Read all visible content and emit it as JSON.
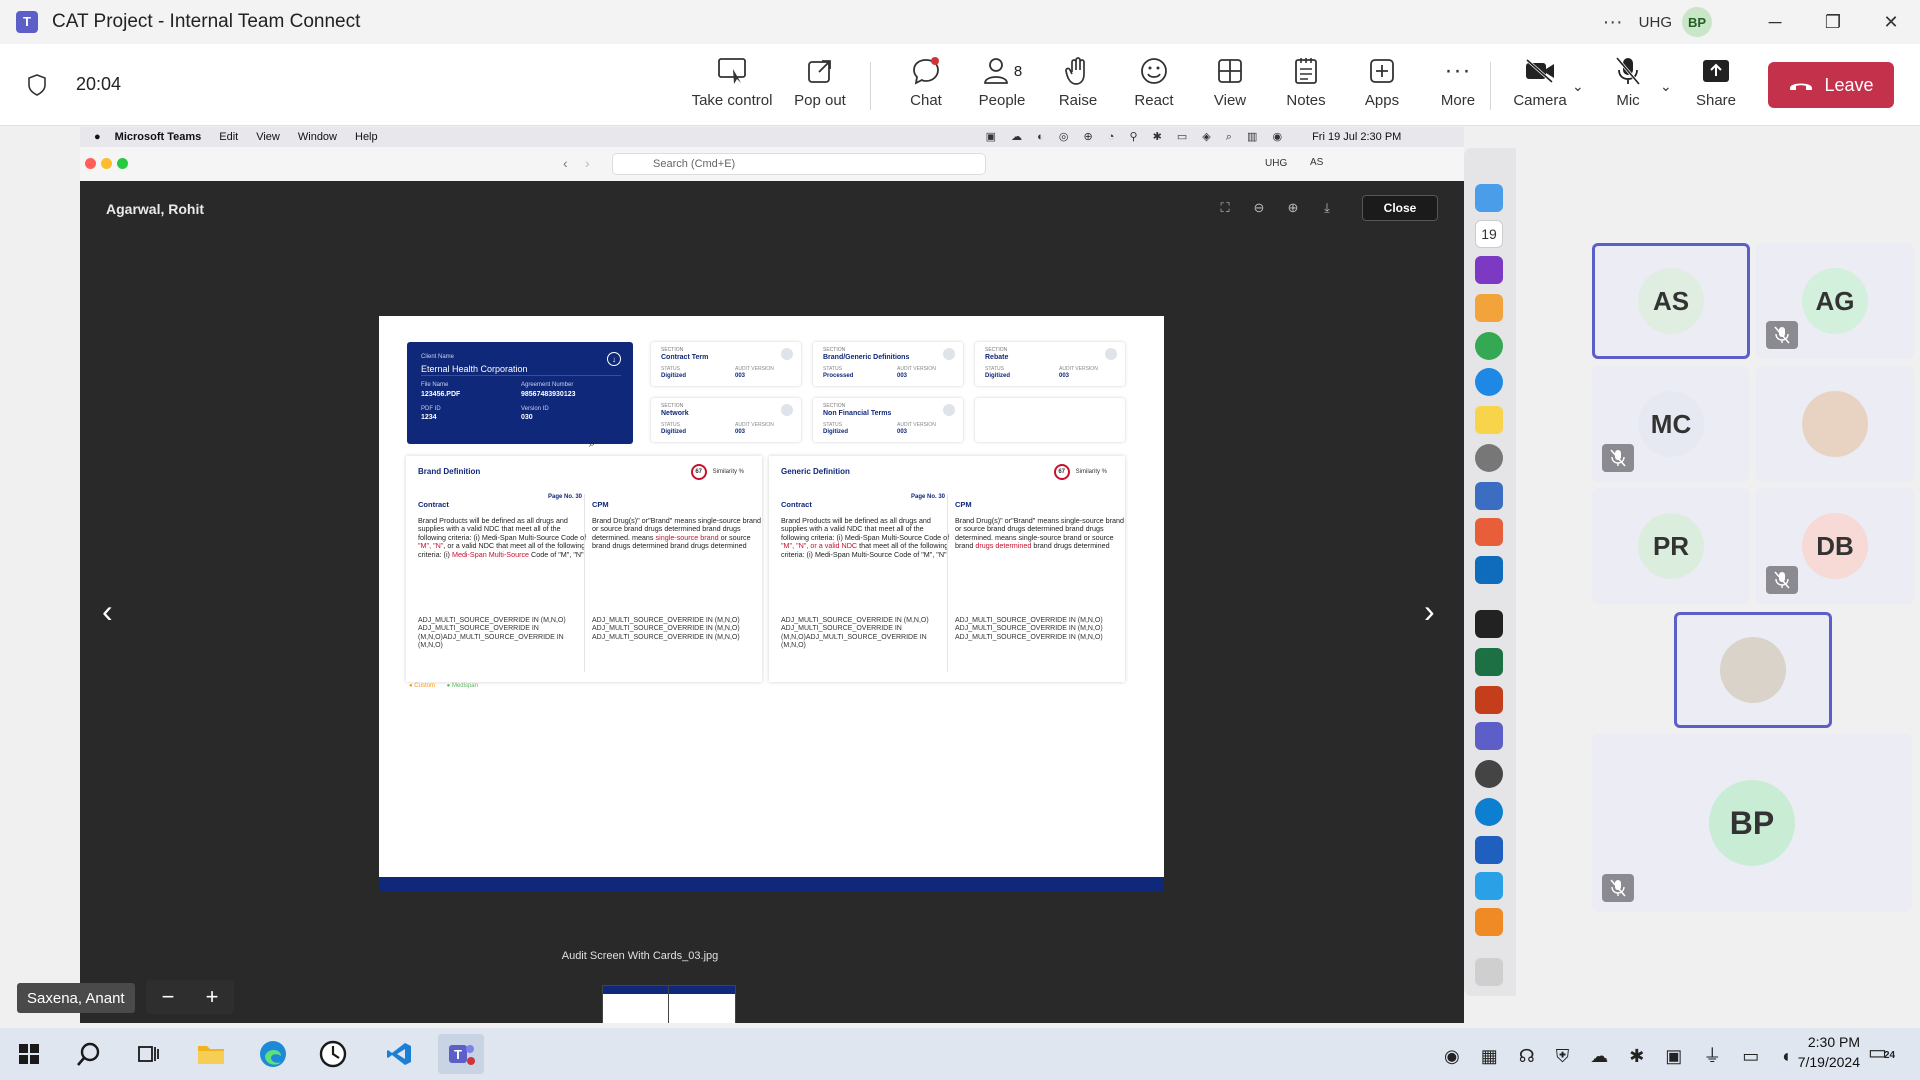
{
  "window": {
    "title": "CAT Project - Internal Team Connect",
    "org": "UHG",
    "user_initials": "BP"
  },
  "toolbar": {
    "timer": "20:04",
    "take_control": "Take control",
    "pop_out": "Pop out",
    "chat": "Chat",
    "people": "People",
    "people_count": "8",
    "raise": "Raise",
    "react": "React",
    "view": "View",
    "notes": "Notes",
    "apps": "Apps",
    "more": "More",
    "camera": "Camera",
    "mic": "Mic",
    "share": "Share",
    "leave": "Leave"
  },
  "mac_menubar": {
    "app": "Microsoft Teams",
    "items": [
      "Edit",
      "View",
      "Window",
      "Help"
    ],
    "datetime": "Fri 19 Jul  2:30 PM"
  },
  "teams_inner": {
    "search_placeholder": "Search (Cmd+E)",
    "org": "UHG",
    "user": "AS"
  },
  "viewer": {
    "sender": "Agarwal, Rohit",
    "close": "Close",
    "file_caption": "Audit Screen With Cards_03.jpg"
  },
  "doc": {
    "client_name_label": "Client Name",
    "client_name": "Eternal Health Corporation",
    "file_name_label": "File Name",
    "file_name": "123456.PDF",
    "agreement_label": "Agreement Number",
    "agreement": "98567483930123",
    "pdf_id_label": "PDF ID",
    "pdf_id": "1234",
    "version_label": "Version ID",
    "version": "030",
    "sections": [
      {
        "label": "SECTION",
        "title": "Contract Term",
        "status_label": "STATUS",
        "status": "Digitized",
        "audit_label": "AUDIT VERSION",
        "audit": "003"
      },
      {
        "label": "SECTION",
        "title": "Brand/Generic Definitions",
        "status_label": "STATUS",
        "status": "Processed",
        "audit_label": "AUDIT VERSION",
        "audit": "003"
      },
      {
        "label": "SECTION",
        "title": "Rebate",
        "status_label": "STATUS",
        "status": "Digitized",
        "audit_label": "AUDIT VERSION",
        "audit": "003"
      },
      {
        "label": "SECTION",
        "title": "Network",
        "status_label": "STATUS",
        "status": "Digitized",
        "audit_label": "AUDIT VERSION",
        "audit": "003"
      },
      {
        "label": "SECTION",
        "title": "Non Financial Terms",
        "status_label": "STATUS",
        "status": "Digitized",
        "audit_label": "AUDIT VERSION",
        "audit": "003"
      }
    ],
    "panels": [
      {
        "title": "Brand Definition",
        "similarity": "67",
        "similarity_label": "Similarity %",
        "contract_head": "Contract",
        "page": "Page No. 30",
        "cpm_head": "CPM",
        "contract_text_a": "Brand Products will be defined as all drugs and supplies with a valid NDC that meet all of the following criteria: (i) Medi-Span Multi-Source Code of ",
        "contract_red_a": "\"M\", \"N\"",
        "contract_text_b": ", or a valid NDC that meet all of the following criteria: (i) ",
        "contract_red_b": "Medi-Span Multi-Source",
        "contract_text_c": " Code of \"M\", \"N\"",
        "cpm_text_a": "Brand Drug(s)\" or\"Brand\" means single-source brand or source brand drugs determined brand drugs determined. means ",
        "cpm_red_a": "single-source brand",
        "cpm_text_b": " or source brand drugs determined brand drugs determined",
        "code_left": "ADJ_MULTI_SOURCE_OVERRIDE IN (M,N,O) ADJ_MULTI_SOURCE_OVERRIDE IN (M,N,O)ADJ_MULTI_SOURCE_OVERRIDE IN (M,N,O)",
        "code_right": "ADJ_MULTI_SOURCE_OVERRIDE IN (M,N,O) ADJ_MULTI_SOURCE_OVERRIDE IN (M,N,O) ADJ_MULTI_SOURCE_OVERRIDE IN (M,N,O)"
      },
      {
        "title": "Generic Definition",
        "similarity": "67",
        "similarity_label": "Similarity %",
        "contract_head": "Contract",
        "page": "Page No. 30",
        "cpm_head": "CPM",
        "contract_text_a": "Brand Products will be defined as all drugs and supplies with a valid NDC that meet all of the following criteria: (i) Medi-Span Multi-Source Code of ",
        "contract_red_a": "\"M\", \"N\", or a valid NDC",
        "contract_text_b": " that meet all of the following criteria: (i) Medi-Span Multi-Source Code of \"M\", \"N\"",
        "contract_red_b": "",
        "contract_text_c": "",
        "cpm_text_a": "Brand Drug(s)\" or\"Brand\" means single-source brand or source brand drugs determined brand drugs determined. means single-source brand or source brand ",
        "cpm_red_a": "drugs determined",
        "cpm_text_b": " brand drugs determined",
        "code_left": "ADJ_MULTI_SOURCE_OVERRIDE IN (M,N,O) ADJ_MULTI_SOURCE_OVERRIDE IN (M,N,O)ADJ_MULTI_SOURCE_OVERRIDE IN (M,N,O)",
        "code_right": "ADJ_MULTI_SOURCE_OVERRIDE IN (M,N,O) ADJ_MULTI_SOURCE_OVERRIDE IN (M,N,O) ADJ_MULTI_SOURCE_OVERRIDE IN (M,N,O)"
      }
    ],
    "legend_custom": "Custom",
    "legend_medispan": "Medispan"
  },
  "participants": [
    {
      "initials": "AS",
      "muted": false,
      "active": true,
      "color": "#dfeee0"
    },
    {
      "initials": "AG",
      "muted": true,
      "active": false,
      "color": "#d3f0dc"
    },
    {
      "initials": "MC",
      "muted": true,
      "active": false,
      "color": "#e6e9f2"
    },
    {
      "initials": "",
      "muted": false,
      "active": false,
      "color": "#e8d3c3"
    },
    {
      "initials": "PR",
      "muted": false,
      "active": false,
      "color": "#dbeedd"
    },
    {
      "initials": "DB",
      "muted": true,
      "active": false,
      "color": "#f7d9d6"
    },
    {
      "initials": "",
      "muted": false,
      "active": true,
      "color": "#d9d3c9"
    },
    {
      "initials": "BP",
      "muted": true,
      "active": false,
      "color": "#c9ecd4"
    }
  ],
  "presenter": {
    "name": "Saxena, Anant"
  },
  "taskbar": {
    "time": "2:30 PM",
    "date": "7/19/2024",
    "notification_count": "24"
  }
}
